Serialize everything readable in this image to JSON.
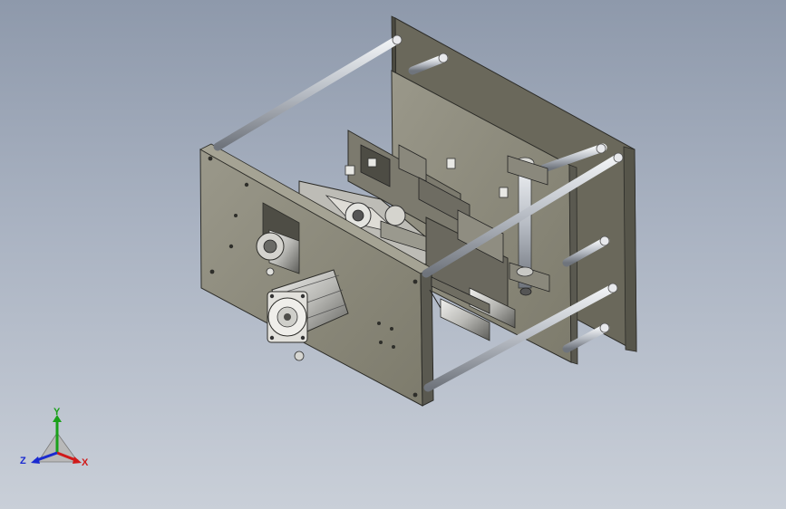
{
  "triad": {
    "x_label": "X",
    "y_label": "Y",
    "z_label": "Z"
  },
  "colors": {
    "background_top": "#8e99ab",
    "background_bottom": "#c9cfd8",
    "plate": "#8c8a7a",
    "plate_dark": "#5f5d52",
    "rod": "#c8ccd2",
    "axis_x": "#d01a1a",
    "axis_y": "#1aa01a",
    "axis_z": "#1a2ad0"
  }
}
